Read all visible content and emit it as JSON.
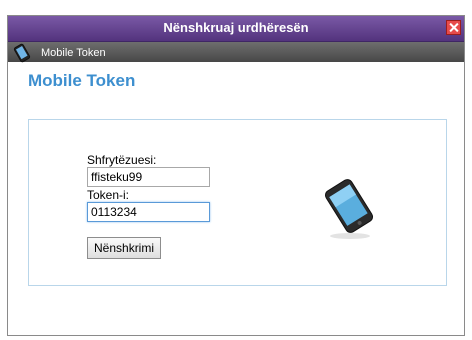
{
  "window": {
    "title": "Nënshkruaj urdhëresën"
  },
  "subbar": {
    "label": "Mobile Token"
  },
  "heading": "Mobile Token",
  "form": {
    "username_label": "Shfrytëzuesi:",
    "username_value": "ffisteku99",
    "token_label": "Token-i:",
    "token_value": "0113234",
    "submit_label": "Nënshkrimi"
  },
  "icons": {
    "close": "close-icon",
    "phone_small": "mobile-phone-icon",
    "phone_large": "mobile-phone-icon"
  },
  "colors": {
    "titlebar": "#53337d",
    "accent": "#3d8fcf",
    "close": "#e74b4b"
  }
}
